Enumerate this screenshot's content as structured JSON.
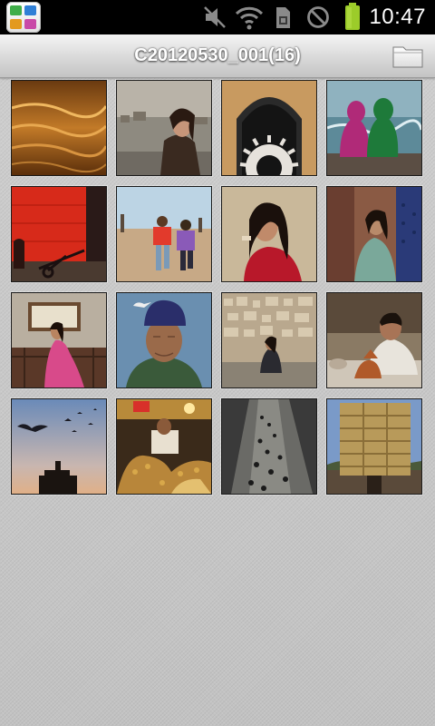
{
  "status_bar": {
    "time": "10:47",
    "icons": [
      "app-launcher-icon",
      "muted-volume-icon",
      "wifi-icon",
      "sim-card-icon",
      "do-not-disturb-icon",
      "battery-icon"
    ],
    "battery_color": "#9ccc2a"
  },
  "action_bar": {
    "title": "C20120530_001(16)",
    "folder_icon": "folder-icon"
  },
  "grid": {
    "columns": 4,
    "thumbnails": [
      {
        "name": "photo-sand-ripples-sunset"
      },
      {
        "name": "photo-woman-city-overlook"
      },
      {
        "name": "photo-arch-gear-sculpture"
      },
      {
        "name": "photo-two-women-sea"
      },
      {
        "name": "photo-red-wall-cart"
      },
      {
        "name": "photo-children-running-beach"
      },
      {
        "name": "photo-woman-red-dress"
      },
      {
        "name": "photo-woman-blue-door"
      },
      {
        "name": "photo-woman-pink-dress-window"
      },
      {
        "name": "photo-old-man-blue-cap"
      },
      {
        "name": "photo-woman-rooftop-city"
      },
      {
        "name": "photo-man-pottery-stall"
      },
      {
        "name": "photo-birds-dusk-tower"
      },
      {
        "name": "photo-market-spices-vendor"
      },
      {
        "name": "photo-aerial-street-crowd"
      },
      {
        "name": "photo-hay-bale-stack"
      }
    ]
  },
  "colors": {
    "background": "#c9c9c9",
    "action_bar_top": "#f4f4f4",
    "action_bar_bottom": "#c4c4c4",
    "title_text": "#ffffff"
  }
}
